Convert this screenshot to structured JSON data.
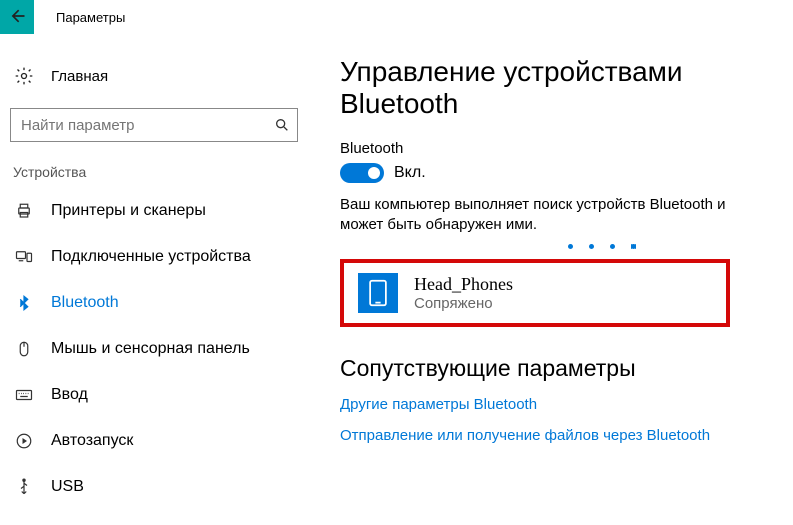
{
  "topbar": {
    "title": "Параметры"
  },
  "sidebar": {
    "home": "Главная",
    "search_placeholder": "Найти параметр",
    "group": "Устройства",
    "items": [
      {
        "label": "Принтеры и сканеры"
      },
      {
        "label": "Подключенные устройства"
      },
      {
        "label": "Bluetooth"
      },
      {
        "label": "Мышь и сенсорная панель"
      },
      {
        "label": "Ввод"
      },
      {
        "label": "Автозапуск"
      },
      {
        "label": "USB"
      }
    ]
  },
  "main": {
    "heading": "Управление устройствами Bluetooth",
    "toggle_label": "Bluetooth",
    "toggle_state": "Вкл.",
    "discover_text": "Ваш компьютер выполняет поиск устройств Bluetooth и может быть обнаружен ими.",
    "device": {
      "name": "Head_Phones",
      "status": "Сопряжено"
    },
    "related_heading": "Сопутствующие параметры",
    "link1": "Другие параметры Bluetooth",
    "link2": "Отправление или получение файлов через Bluetooth"
  }
}
